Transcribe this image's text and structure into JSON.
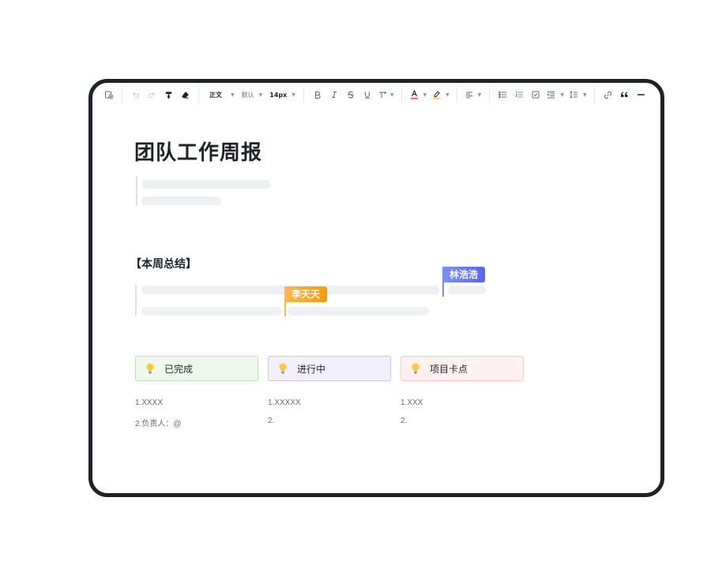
{
  "toolbar": {
    "paragraph_style": "正文",
    "font_family": "默认",
    "font_size": "14px",
    "text_color": "#f54a45",
    "highlight_color": "#fad355"
  },
  "document": {
    "title": "团队工作周报",
    "section_heading": "【本周总结】"
  },
  "collaborators": [
    {
      "name": "林浩浩",
      "color_from": "#7b8ffb",
      "color_to": "#5865f2"
    },
    {
      "name": "李天天",
      "color_from": "#ffb84d",
      "color_to": "#f59a0c"
    }
  ],
  "status_cards": [
    {
      "label": "已完成",
      "bg": "#eef9ec",
      "border": "#b7e4b0",
      "items": [
        "1.XXXX",
        "2.负责人：@"
      ]
    },
    {
      "label": "进行中",
      "bg": "#f3f0fe",
      "border": "#cbc1f5",
      "items": [
        "1.XXXXX",
        "2."
      ]
    },
    {
      "label": "项目卡点",
      "bg": "#fef1f0",
      "border": "#f5c9c6",
      "items": [
        "1.XXX",
        "2."
      ]
    }
  ],
  "icons": {
    "insert": "insert-block-icon",
    "undo": "undo-icon",
    "redo": "redo-icon",
    "format_painter": "format-painter-icon",
    "clear_format": "eraser-icon",
    "bold": "bold-icon",
    "italic": "italic-icon",
    "strikethrough": "strikethrough-icon",
    "underline": "underline-icon",
    "more_text": "text-more-icon",
    "align": "align-left-icon",
    "bulleted_list": "bulleted-list-icon",
    "numbered_list": "numbered-list-icon",
    "checklist": "checklist-icon",
    "indent": "indent-icon",
    "line_height": "line-height-icon",
    "link": "link-icon",
    "quote": "quote-icon",
    "divider": "divider-icon",
    "status_bulb": "lightbulb-icon"
  }
}
